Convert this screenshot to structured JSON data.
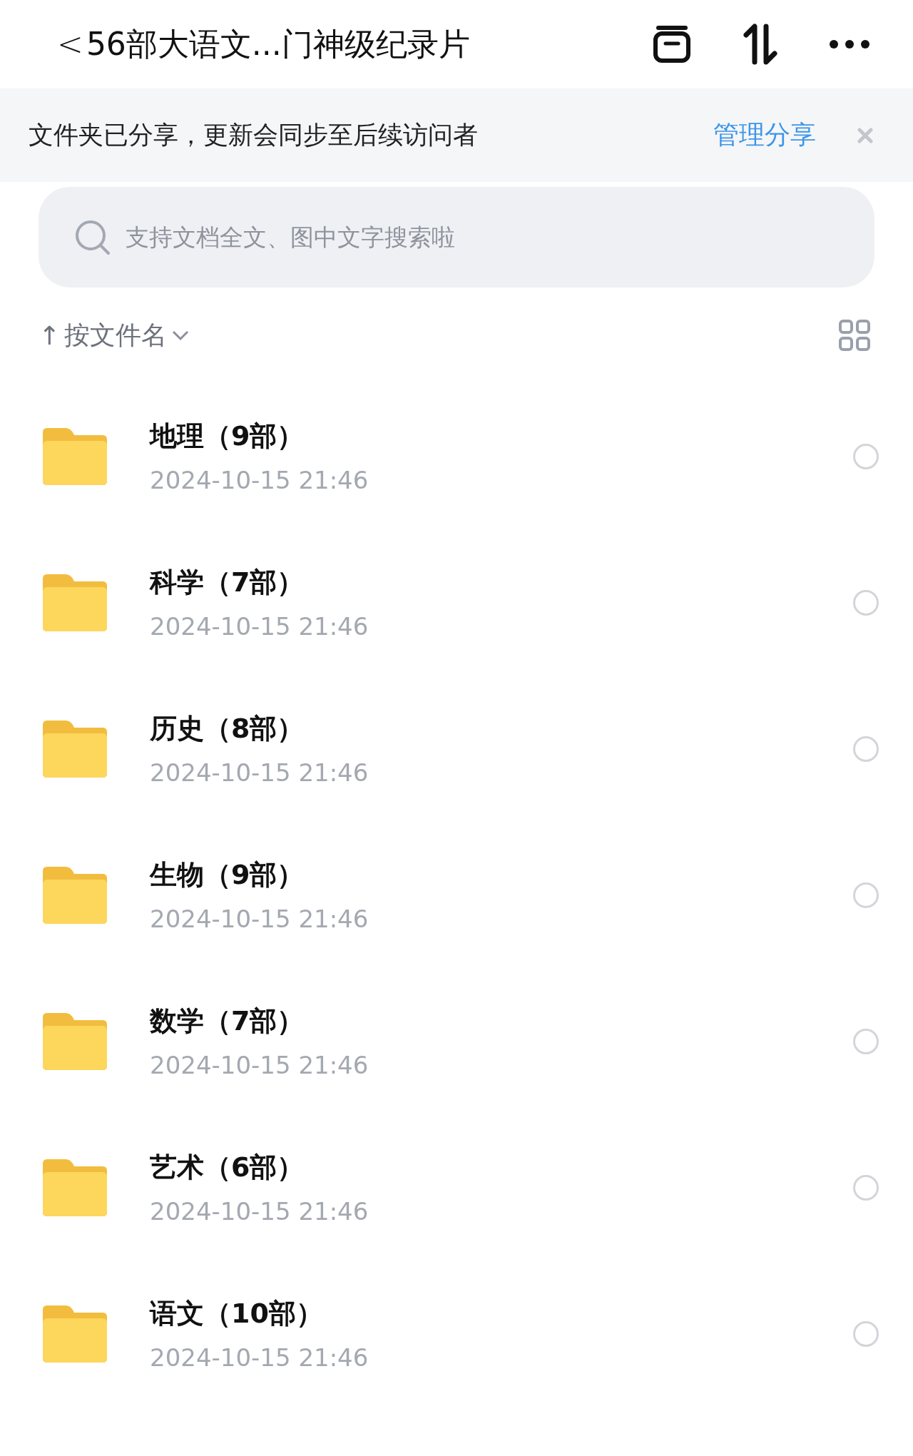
{
  "header": {
    "back": "<",
    "title": "56部大语文...门神级纪录片"
  },
  "banner": {
    "message": "文件夹已分享，更新会同步至后续访问者",
    "action": "管理分享"
  },
  "search": {
    "placeholder": "支持文档全文、图中文字搜索啦"
  },
  "sort": {
    "arrow": "↑",
    "label": "按文件名"
  },
  "folders": [
    {
      "name": "地理（9部）",
      "date": "2024-10-15 21:46",
      "selected": false
    },
    {
      "name": "科学（7部）",
      "date": "2024-10-15 21:46",
      "selected": false
    },
    {
      "name": "历史（8部）",
      "date": "2024-10-15 21:46",
      "selected": false
    },
    {
      "name": "生物（9部）",
      "date": "2024-10-15 21:46",
      "selected": false
    },
    {
      "name": "数学（7部）",
      "date": "2024-10-15 21:46",
      "selected": false
    },
    {
      "name": "艺术（6部）",
      "date": "2024-10-15 21:46",
      "selected": false
    },
    {
      "name": "语文（10部）",
      "date": "2024-10-15 21:46",
      "selected": false
    }
  ]
}
